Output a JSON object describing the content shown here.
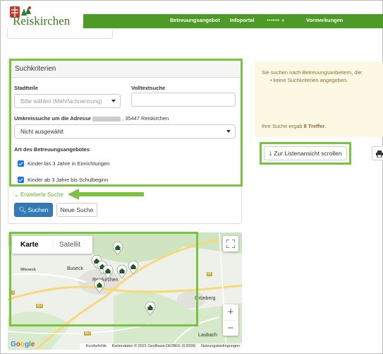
{
  "header": {
    "logo_text": "Reiskirchen",
    "nav": [
      {
        "label": "Betreuungsangebot"
      },
      {
        "label": "Infoportal"
      },
      {
        "label": "•••••••"
      },
      {
        "label": "Vormerkungen"
      }
    ]
  },
  "search": {
    "title": "Suchkriterien",
    "stadtteile_label": "Stadtteile",
    "stadtteile_placeholder": "Bitte wählen (Mehrfachnennung)",
    "volltext_label": "Volltextsuche",
    "volltext_value": "",
    "umkreis_label_prefix": "Umkreissuche um die Adresse",
    "umkreis_label_suffix": ", 35447 Reiskirchen",
    "umkreis_value": "Nicht ausgewählt",
    "art_label": "Art des Betreuungsangebotes",
    "options": [
      {
        "label": "Kinder bis 3 Jahre in Einrichtungen",
        "checked": true
      },
      {
        "label": "Kinder ab 3 Jahre bis Schulbeginn",
        "checked": true
      }
    ],
    "advanced_label": "Erweiterte Suche",
    "search_button": "Suchen",
    "reset_button": "Neue Suche"
  },
  "info": {
    "line1": "Sie suchen nach Betreuungsanbietern, die:",
    "bullet": "keine Suchkriterien angegeben.",
    "result_prefix": "Ihre Suche ergab",
    "result_count": "8 Treffer",
    "result_suffix": "."
  },
  "list_scroll_button": "Zur Listenansicht scrollen",
  "map": {
    "tab_map": "Karte",
    "tab_satellite": "Satellit",
    "places": [
      "Buseck",
      "Reiskirchen",
      "Grünberg",
      "Laubach",
      "Wieseck"
    ],
    "roads": [
      "457",
      "49",
      "49",
      "3",
      "457",
      "457"
    ],
    "google": "Google",
    "attribution": {
      "shortcuts": "Kurzbefehle",
      "data": "Kartendaten © 2021 GeoBasis-DE/BKG (©2009)",
      "terms": "Nutzungsbedingungen"
    },
    "zoom_in": "+",
    "zoom_out": "−",
    "pins": 8
  },
  "colors": {
    "brand_green": "#4e9a26",
    "highlight": "#7cc242",
    "primary": "#337ab7",
    "warning_bg": "#fcf8e3",
    "warning_text": "#8a6d3b"
  }
}
